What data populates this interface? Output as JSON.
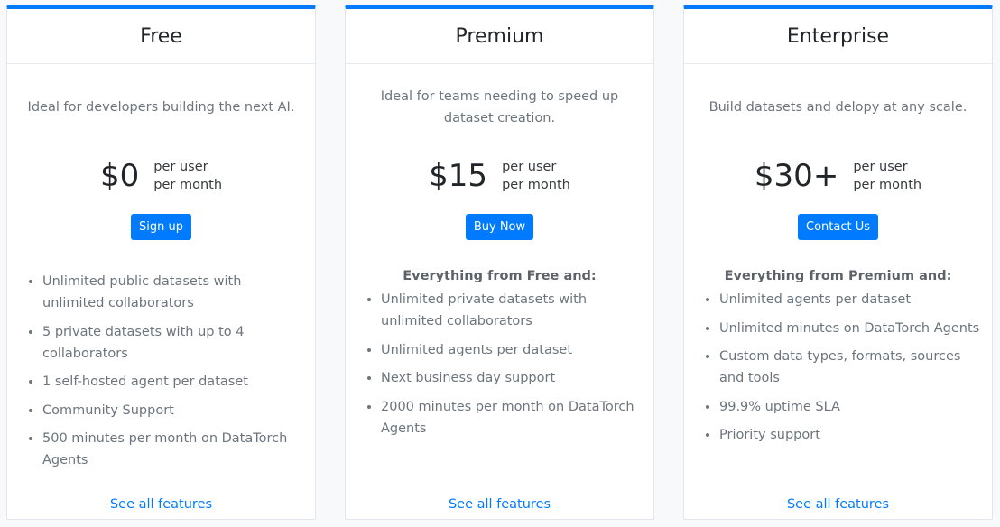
{
  "accent_color": "#007bff",
  "plans": [
    {
      "name": "Free",
      "description": "Ideal for developers building the next AI.",
      "price": "$0",
      "unit_line1": "per user",
      "unit_line2": "per month",
      "button_label": "Sign up",
      "features_lead": "",
      "features": [
        "Unlimited public datasets with unlimited collaborators",
        "5 private datasets with up to 4 collaborators",
        "1 self-hosted agent per dataset",
        "Community Support",
        "500 minutes per month on DataTorch Agents"
      ],
      "see_all_label": "See all features"
    },
    {
      "name": "Premium",
      "description": "Ideal for teams needing to speed up dataset creation.",
      "price": "$15",
      "unit_line1": "per user",
      "unit_line2": "per month",
      "button_label": "Buy Now",
      "features_lead": "Everything from Free and:",
      "features": [
        "Unlimited private datasets with unlimited collaborators",
        "Unlimited agents per dataset",
        "Next business day support",
        "2000 minutes per month on DataTorch Agents"
      ],
      "see_all_label": "See all features"
    },
    {
      "name": "Enterprise",
      "description": "Build datasets and delopy at any scale.",
      "price": "$30+",
      "unit_line1": "per user",
      "unit_line2": "per month",
      "button_label": "Contact Us",
      "features_lead": "Everything from Premium and:",
      "features": [
        "Unlimited agents per dataset",
        "Unlimited minutes on DataTorch Agents",
        "Custom data types, formats, sources and tools",
        "99.9% uptime SLA",
        "Priority support"
      ],
      "see_all_label": "See all features"
    }
  ]
}
